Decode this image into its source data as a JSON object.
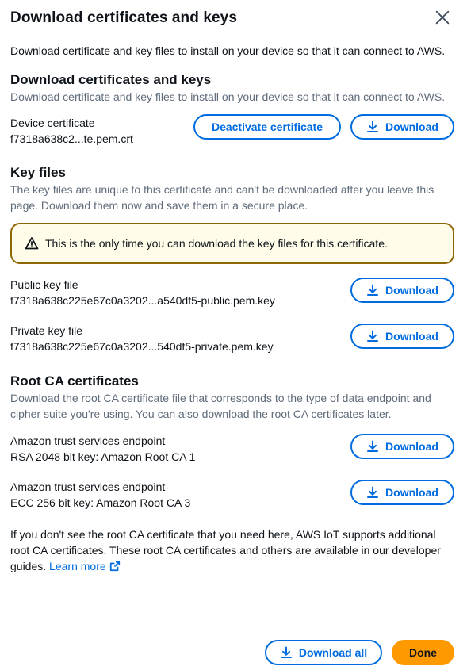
{
  "modal": {
    "title": "Download certificates and keys",
    "intro": "Download certificate and key files to install on your device so that it can connect to AWS."
  },
  "cert_section": {
    "title": "Download certificates and keys",
    "description": "Download certificate and key files to install on your device so that it can connect to AWS.",
    "device_cert": {
      "label": "Device certificate",
      "value": "f7318a638c2...te.pem.crt",
      "deactivate_label": "Deactivate certificate",
      "download_label": "Download"
    }
  },
  "key_section": {
    "title": "Key files",
    "description": "The key files are unique to this certificate and can't be downloaded after you leave this page. Download them now and save them in a secure place.",
    "alert": "This is the only time you can download the key files for this certificate.",
    "public_key": {
      "label": "Public key file",
      "value": "f7318a638c225e67c0a3202...a540df5-public.pem.key",
      "download_label": "Download"
    },
    "private_key": {
      "label": "Private key file",
      "value": "f7318a638c225e67c0a3202...540df5-private.pem.key",
      "download_label": "Download"
    }
  },
  "root_ca_section": {
    "title": "Root CA certificates",
    "description": "Download the root CA certificate file that corresponds to the type of data endpoint and cipher suite you're using. You can also download the root CA certificates later.",
    "items": [
      {
        "label": "Amazon trust services endpoint",
        "value": "RSA 2048 bit key: Amazon Root CA 1",
        "download_label": "Download"
      },
      {
        "label": "Amazon trust services endpoint",
        "value": "ECC 256 bit key: Amazon Root CA 3",
        "download_label": "Download"
      }
    ],
    "footer_text": "If you don't see the root CA certificate that you need here, AWS IoT supports additional root CA certificates. These root CA certificates and others are available in our developer guides.",
    "learn_more": "Learn more"
  },
  "footer": {
    "download_all": "Download all",
    "done": "Done"
  },
  "colors": {
    "primary": "#006ce0",
    "done_button": "#ff9900",
    "warning_border": "#8d6605",
    "warning_background": "#fffce9"
  },
  "icons": {
    "close": "close-icon",
    "download": "download-icon",
    "warning": "warning-icon",
    "external": "external-link-icon"
  }
}
